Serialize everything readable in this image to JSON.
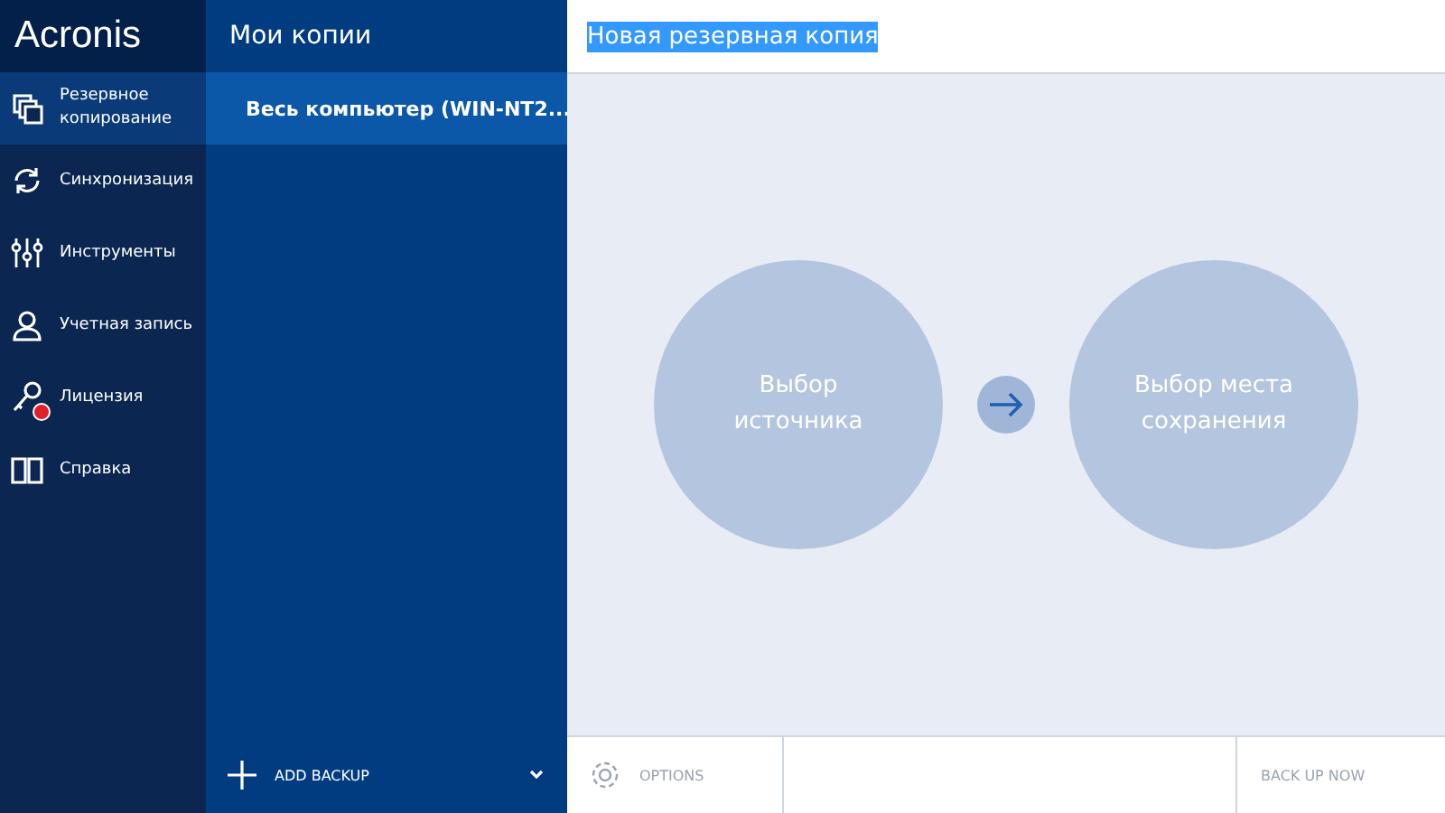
{
  "logo": "Acronis",
  "sidebar": {
    "items": [
      {
        "label": "Резервное копирование",
        "selected": true,
        "alert": false
      },
      {
        "label": "Синхронизация",
        "selected": false,
        "alert": false
      },
      {
        "label": "Инструменты",
        "selected": false,
        "alert": false
      },
      {
        "label": "Учетная запись",
        "selected": false,
        "alert": false
      },
      {
        "label": "Лицензия",
        "selected": false,
        "alert": true
      },
      {
        "label": "Справка",
        "selected": false,
        "alert": false
      }
    ]
  },
  "backups": {
    "title": "Мои копии",
    "items": [
      {
        "label": "Весь компьютер (WIN-NT2...",
        "selected": true
      }
    ],
    "add_button": "ADD BACKUP"
  },
  "main": {
    "title_field": {
      "value": "Новая резервная копия",
      "text_selected": true
    },
    "source": "Выбор источника",
    "destination": "Выбор места сохранения",
    "options_button": "OPTIONS",
    "backup_button": "BACK UP NOW"
  }
}
